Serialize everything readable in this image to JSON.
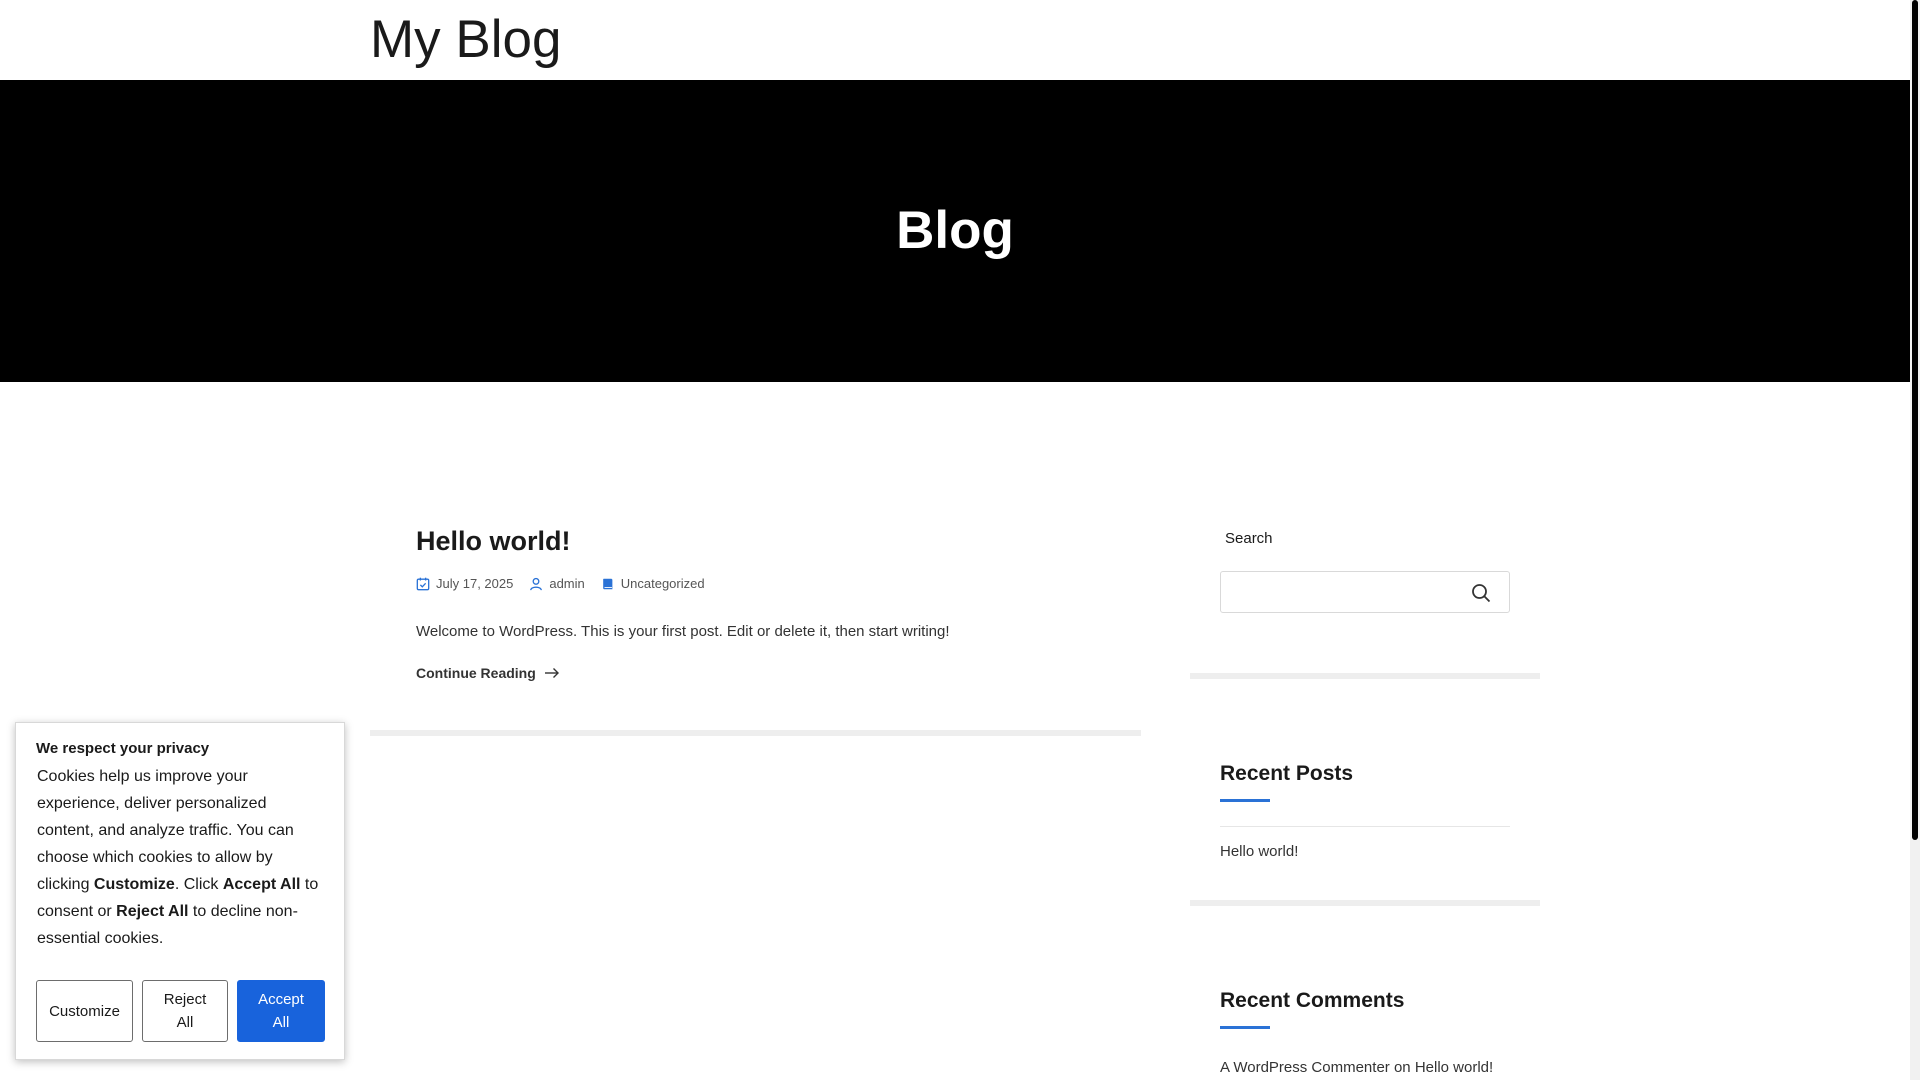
{
  "site": {
    "title": "My Blog"
  },
  "hero": {
    "title": "Blog"
  },
  "post": {
    "title": "Hello world!",
    "date": "July 17, 2025",
    "author": "admin",
    "category": "Uncategorized",
    "excerpt": "Welcome to WordPress. This is your first post. Edit or delete it, then start writing!",
    "read_more": "Continue Reading"
  },
  "sidebar": {
    "search": {
      "label": "Search",
      "placeholder": "",
      "value": ""
    },
    "recent_posts": {
      "heading": "Recent Posts",
      "items": [
        "Hello world!"
      ]
    },
    "recent_comments": {
      "heading": "Recent Comments",
      "items": [
        {
          "author": "A WordPress Commenter",
          "connector": "on",
          "post": "Hello world!"
        }
      ]
    }
  },
  "cookie_banner": {
    "title": "We respect your privacy",
    "body_parts": {
      "p1": "Cookies help us improve your experience, deliver personalized content, and analyze traffic. You can choose which cookies to allow by clicking ",
      "b1": "Customize",
      "p2": ". Click ",
      "b2": "Accept All",
      "p3": " to consent or ",
      "b3": "Reject All",
      "p4": " to decline non-essential cookies."
    },
    "buttons": {
      "customize": "Customize",
      "reject": "Reject All",
      "accept": "Accept All"
    }
  },
  "colors": {
    "accent": "#2a72d6",
    "accept_button": "#1863dc",
    "hero_bg": "#000000",
    "divider": "#eeeeee"
  },
  "icons": {
    "date": "calendar-check-icon",
    "author": "user-icon",
    "category": "folder-icon",
    "read_more": "arrow-right-icon",
    "search": "search-icon"
  }
}
